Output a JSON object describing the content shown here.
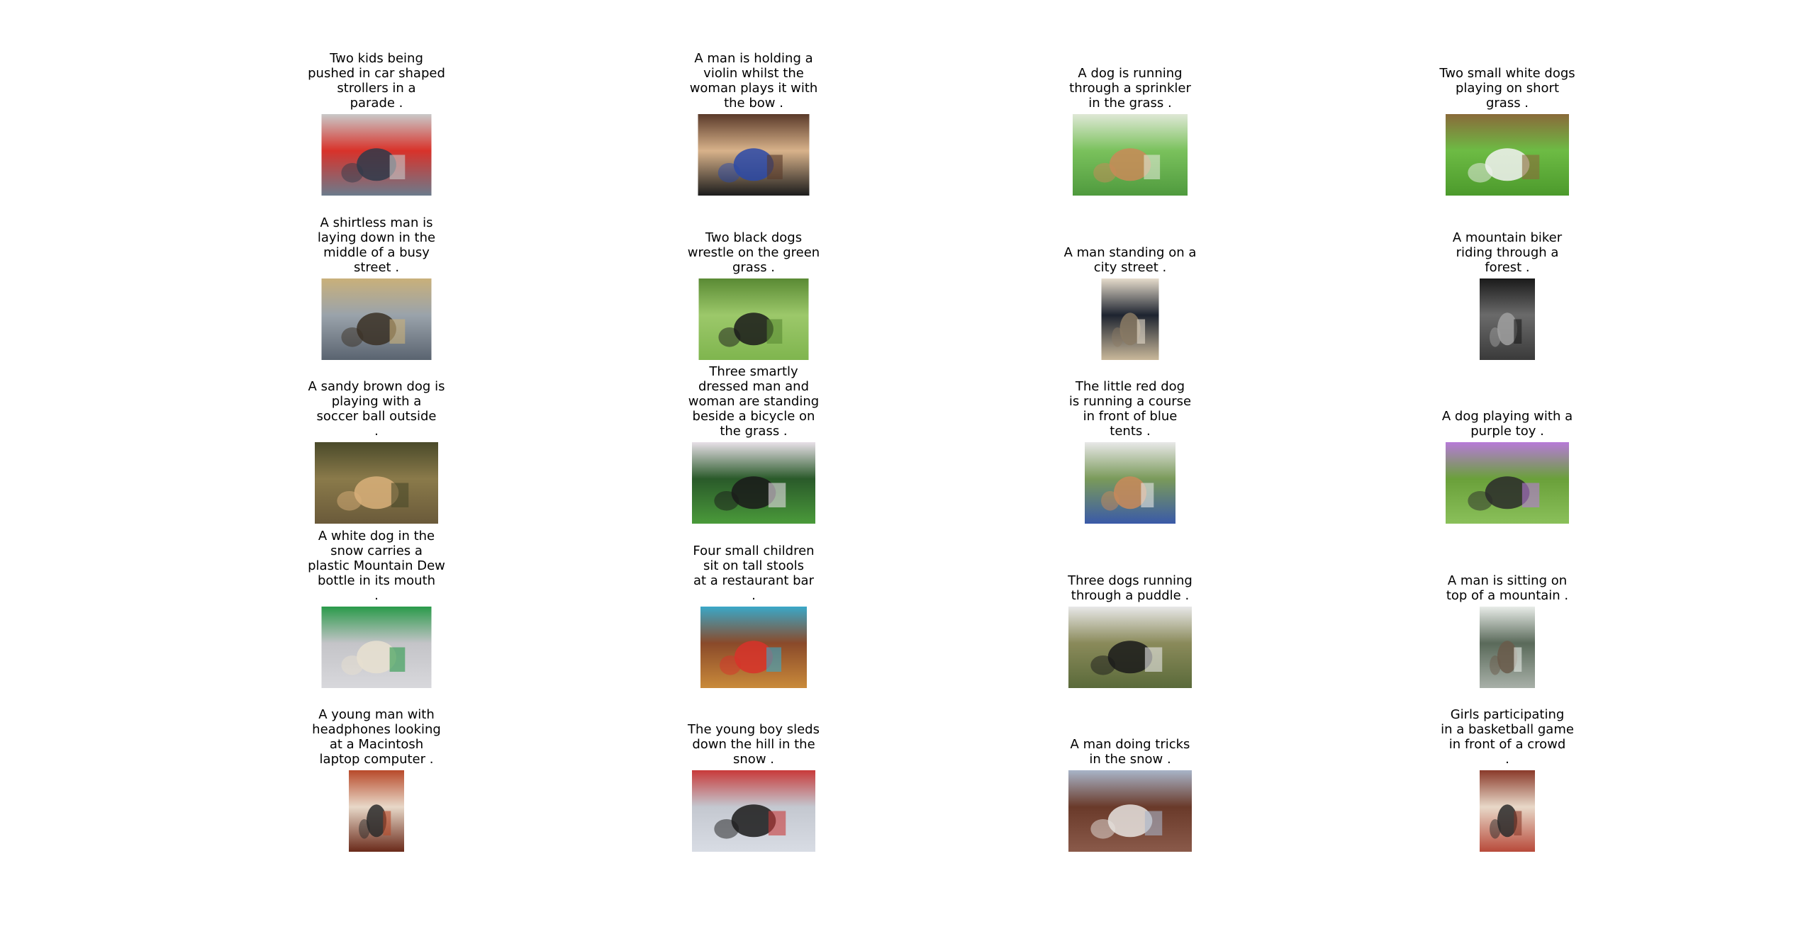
{
  "items": [
    {
      "caption": "Two kids being\npushed in car shaped\nstrollers in a\nparade .",
      "image": "kids-car-strollers-parade",
      "colors": [
        "#6b7b8c",
        "#d8322a",
        "#2f3a4a",
        "#c9c9c9"
      ]
    },
    {
      "caption": "A man is holding a\nviolin whilst the\nwoman plays it with\nthe bow .",
      "image": "man-violin-woman-bow",
      "colors": [
        "#1c1c1c",
        "#d8b28a",
        "#2a49a8",
        "#5a3a2a"
      ]
    },
    {
      "caption": "A dog is running\nthrough a sprinkler\nin the grass .",
      "image": "dog-sprinkler-grass",
      "colors": [
        "#4f9a3e",
        "#7ac15c",
        "#c98a58",
        "#dfe8d6"
      ]
    },
    {
      "caption": "Two small white dogs\nplaying on short\ngrass .",
      "image": "two-white-dogs-grass",
      "colors": [
        "#4c9a2c",
        "#6dbb44",
        "#f2f2f2",
        "#8a6a3a"
      ]
    },
    {
      "caption": "A shirtless man is\nlaying down in the\nmiddle of a busy\nstreet .",
      "image": "man-laying-street",
      "colors": [
        "#5a6470",
        "#9aa3ab",
        "#3a3024",
        "#c9b07a"
      ]
    },
    {
      "caption": "Two black dogs\nwrestle on the green\ngrass .",
      "image": "black-dogs-wrestling",
      "colors": [
        "#7fb54e",
        "#9cc86a",
        "#1a1a1a",
        "#5a8a34"
      ]
    },
    {
      "caption": "A man standing on a\ncity street .",
      "image": "man-city-street",
      "colors": [
        "#c9b89a",
        "#1e2430",
        "#8a7a64",
        "#e6dccb"
      ]
    },
    {
      "caption": "A mountain biker\nriding through a\nforest .",
      "image": "mountain-biker-forest",
      "colors": [
        "#3a3a3a",
        "#6a6a6a",
        "#a0a0a0",
        "#1a1a1a"
      ]
    },
    {
      "caption": "A sandy brown dog is\nplaying with a\nsoccer ball outside\n.",
      "image": "brown-dog-soccer-ball",
      "colors": [
        "#6a5a3a",
        "#8a7a4a",
        "#d9b07a",
        "#4a4a2a"
      ]
    },
    {
      "caption": "Three smartly\ndressed man and\nwoman are standing\nbeside a bicycle on\nthe grass .",
      "image": "people-bicycle-grass",
      "colors": [
        "#4a9a3a",
        "#2a5a2a",
        "#1a1a1a",
        "#e8e0e8"
      ]
    },
    {
      "caption": "The little red dog\nis running a course\nin front of blue\ntents .",
      "image": "red-dog-agility-course",
      "colors": [
        "#3a5aa8",
        "#7a9a5a",
        "#c98a5a",
        "#e8e8e8"
      ]
    },
    {
      "caption": "A dog playing with a\npurple toy .",
      "image": "dog-purple-toy",
      "colors": [
        "#8ac05a",
        "#6aa03a",
        "#2a2a2a",
        "#b77ad8"
      ]
    },
    {
      "caption": "A white dog in the\nsnow carries a\nplastic Mountain Dew\nbottle in its mouth\n.",
      "image": "white-dog-snow-bottle",
      "colors": [
        "#d8d8dc",
        "#c4c4c8",
        "#e8e0d0",
        "#2a9a4a"
      ]
    },
    {
      "caption": "Four small children\nsit on tall stools\nat a restaurant bar\n.",
      "image": "children-restaurant-bar",
      "colors": [
        "#c98a3a",
        "#8a4a2a",
        "#d8322a",
        "#3aa8c8"
      ]
    },
    {
      "caption": "Three dogs running\nthrough a puddle .",
      "image": "three-dogs-puddle",
      "colors": [
        "#5a6a3a",
        "#8a8a5a",
        "#1a1a1a",
        "#e8e8e8"
      ]
    },
    {
      "caption": "A man is sitting on\ntop of a mountain .",
      "image": "man-mountain-top",
      "colors": [
        "#a8b0a8",
        "#5a6a5a",
        "#6a5a4a",
        "#e8ece8"
      ]
    },
    {
      "caption": "A young man with\nheadphones looking\nat a Macintosh\nlaptop computer .",
      "image": "man-headphones-laptop",
      "colors": [
        "#6a2a1a",
        "#e8d8c8",
        "#2a2a2a",
        "#b84a2a"
      ]
    },
    {
      "caption": "The young boy sleds\ndown the hill in the\nsnow .",
      "image": "boy-sledding-snow",
      "colors": [
        "#d8dce4",
        "#c4c8d0",
        "#1a1a1a",
        "#c83a3a"
      ]
    },
    {
      "caption": "A man doing tricks\nin the snow .",
      "image": "man-tricks-snow",
      "colors": [
        "#8a5a4a",
        "#6a3a2a",
        "#e8e4e0",
        "#a8b4c8"
      ]
    },
    {
      "caption": "Girls participating\nin a basketball game\nin front of a crowd\n.",
      "image": "girls-basketball-game",
      "colors": [
        "#b84a3a",
        "#e8d8c8",
        "#2a2a2a",
        "#8a3a2a"
      ]
    }
  ]
}
